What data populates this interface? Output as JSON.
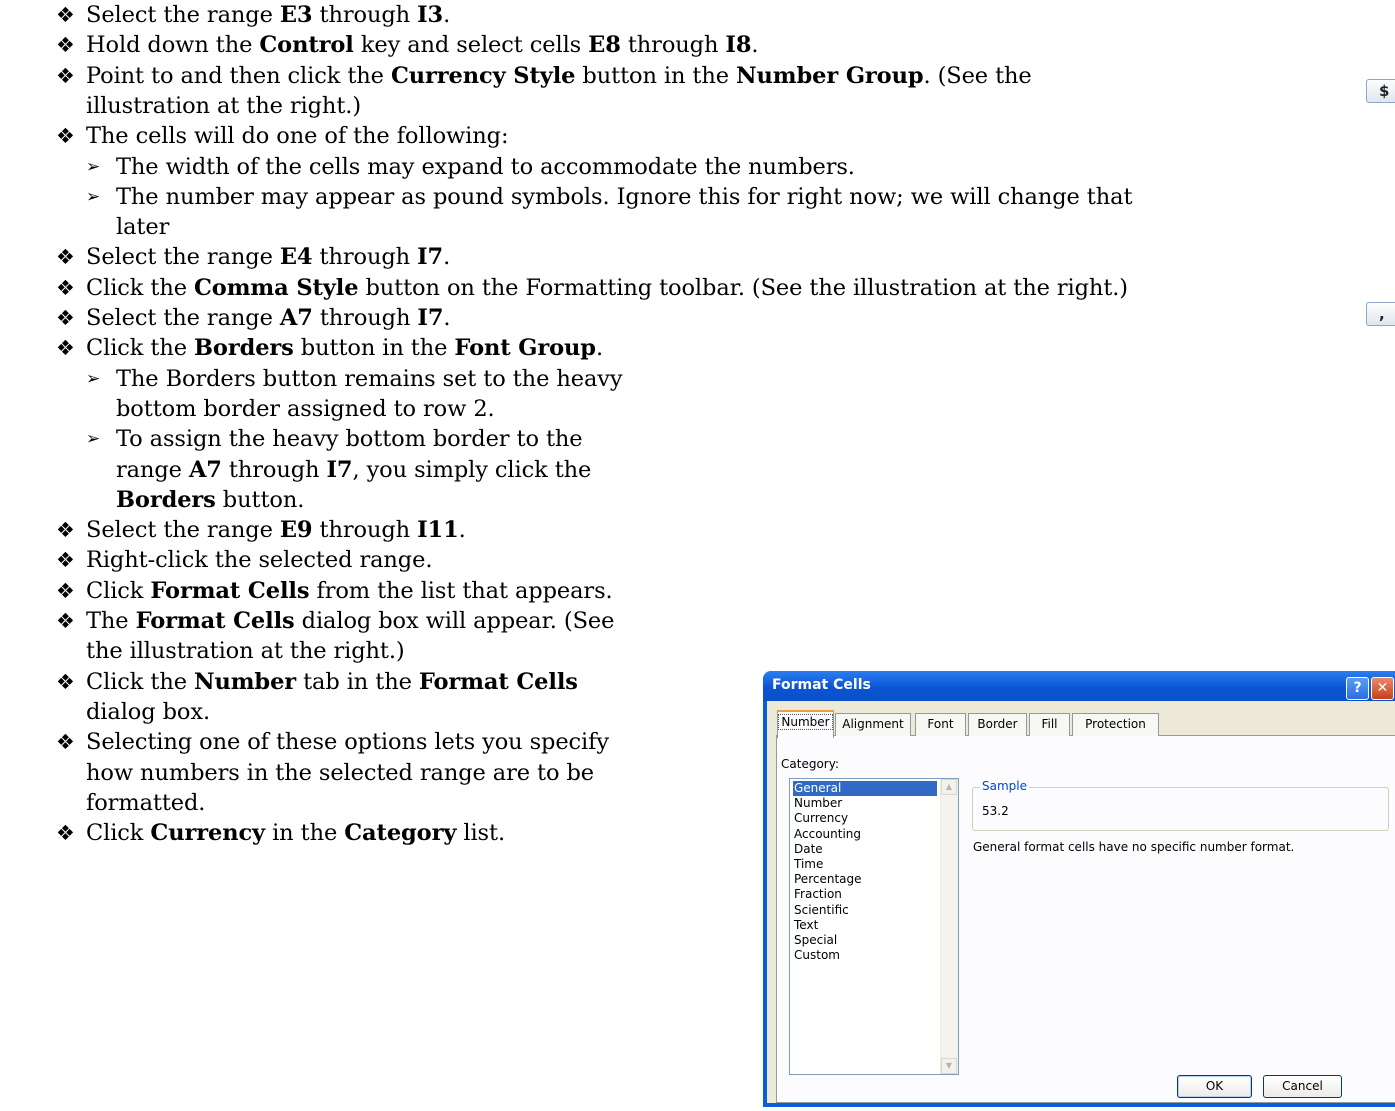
{
  "instructions": [
    {
      "kind": "bullet",
      "parts": [
        {
          "t": "Select the range "
        },
        {
          "t": "E3",
          "b": true
        },
        {
          "t": " through "
        },
        {
          "t": "I3",
          "b": true
        },
        {
          "t": "."
        }
      ]
    },
    {
      "kind": "bullet",
      "parts": [
        {
          "t": "Hold down the "
        },
        {
          "t": "Control",
          "b": true
        },
        {
          "t": " key and select cells "
        },
        {
          "t": "E8",
          "b": true
        },
        {
          "t": " through "
        },
        {
          "t": "I8",
          "b": true
        },
        {
          "t": "."
        }
      ]
    },
    {
      "kind": "bullet",
      "parts": [
        {
          "t": "Point to and then click the "
        },
        {
          "t": "Currency Style",
          "b": true
        },
        {
          "t": " button in the "
        },
        {
          "t": "Number Group",
          "b": true
        },
        {
          "t": ". (See the"
        }
      ]
    },
    {
      "kind": "cont1",
      "parts": [
        {
          "t": "illustration at the right.)"
        }
      ]
    },
    {
      "kind": "bullet",
      "parts": [
        {
          "t": "The cells will do one of the following:"
        }
      ]
    },
    {
      "kind": "arrow",
      "parts": [
        {
          "t": "The width of the cells may expand to accommodate the numbers."
        }
      ]
    },
    {
      "kind": "arrow",
      "parts": [
        {
          "t": "The number may appear as pound symbols. Ignore this for right now; we will change that"
        }
      ]
    },
    {
      "kind": "cont2",
      "parts": [
        {
          "t": "later"
        }
      ]
    },
    {
      "kind": "bullet",
      "parts": [
        {
          "t": "Select the range "
        },
        {
          "t": "E4",
          "b": true
        },
        {
          "t": " through "
        },
        {
          "t": "I7",
          "b": true
        },
        {
          "t": "."
        }
      ]
    },
    {
      "kind": "bullet",
      "parts": [
        {
          "t": "Click the "
        },
        {
          "t": "Comma Style",
          "b": true
        },
        {
          "t": " button on the Formatting toolbar. (See the illustration at the right.)"
        }
      ]
    },
    {
      "kind": "bullet",
      "parts": [
        {
          "t": "Select the range "
        },
        {
          "t": "A7",
          "b": true
        },
        {
          "t": " through "
        },
        {
          "t": "I7",
          "b": true
        },
        {
          "t": "."
        }
      ]
    },
    {
      "kind": "bullet",
      "parts": [
        {
          "t": "Click the "
        },
        {
          "t": "Borders",
          "b": true
        },
        {
          "t": " button in the "
        },
        {
          "t": "Font Group",
          "b": true
        },
        {
          "t": "."
        }
      ]
    },
    {
      "kind": "arrow",
      "parts": [
        {
          "t": "The Borders button remains set to the heavy"
        }
      ]
    },
    {
      "kind": "cont2",
      "parts": [
        {
          "t": "bottom border assigned to row 2."
        }
      ]
    },
    {
      "kind": "arrow",
      "parts": [
        {
          "t": "To assign the heavy bottom border to the"
        }
      ]
    },
    {
      "kind": "cont2",
      "parts": [
        {
          "t": "range "
        },
        {
          "t": "A7",
          "b": true
        },
        {
          "t": " through "
        },
        {
          "t": "I7",
          "b": true
        },
        {
          "t": ", you simply click the"
        }
      ]
    },
    {
      "kind": "cont2",
      "parts": [
        {
          "t": "Borders",
          "b": true
        },
        {
          "t": " button."
        }
      ]
    },
    {
      "kind": "bullet",
      "parts": [
        {
          "t": "Select the range "
        },
        {
          "t": "E9",
          "b": true
        },
        {
          "t": " through "
        },
        {
          "t": "I11",
          "b": true
        },
        {
          "t": "."
        }
      ]
    },
    {
      "kind": "bullet",
      "parts": [
        {
          "t": "Right-click the selected range."
        }
      ]
    },
    {
      "kind": "bullet",
      "parts": [
        {
          "t": "Click "
        },
        {
          "t": "Format Cells",
          "b": true
        },
        {
          "t": " from the list that appears."
        }
      ]
    },
    {
      "kind": "bullet",
      "parts": [
        {
          "t": "The "
        },
        {
          "t": "Format Cells",
          "b": true
        },
        {
          "t": " dialog box will appear. (See"
        }
      ]
    },
    {
      "kind": "cont1",
      "parts": [
        {
          "t": "the illustration at the right.)"
        }
      ]
    },
    {
      "kind": "bullet",
      "parts": [
        {
          "t": "Click the "
        },
        {
          "t": "Number",
          "b": true
        },
        {
          "t": " tab in the "
        },
        {
          "t": "Format Cells",
          "b": true
        }
      ]
    },
    {
      "kind": "cont1",
      "parts": [
        {
          "t": "dialog box."
        }
      ]
    },
    {
      "kind": "bullet",
      "parts": [
        {
          "t": "Selecting one of these options lets you specify"
        }
      ]
    },
    {
      "kind": "cont1",
      "parts": [
        {
          "t": "how numbers in the selected range are to be"
        }
      ]
    },
    {
      "kind": "cont1",
      "parts": [
        {
          "t": "formatted."
        }
      ]
    },
    {
      "kind": "bullet",
      "parts": [
        {
          "t": "Click "
        },
        {
          "t": "Currency",
          "b": true
        },
        {
          "t": " in the "
        },
        {
          "t": "Category",
          "b": true
        },
        {
          "t": " list."
        }
      ]
    }
  ],
  "bullet_glyph": "❖",
  "arrow_glyph": "➢",
  "toolbar_illustrations": {
    "currency_glyph": "$",
    "comma_glyph": ","
  },
  "dialog": {
    "title": "Format Cells",
    "help_glyph": "?",
    "close_glyph": "✕",
    "tabs": [
      "Number",
      "Alignment",
      "Font",
      "Border",
      "Fill",
      "Protection"
    ],
    "active_tab": "Number",
    "category_label": "Category:",
    "categories": [
      "General",
      "Number",
      "Currency",
      "Accounting",
      "Date",
      "Time",
      "Percentage",
      "Fraction",
      "Scientific",
      "Text",
      "Special",
      "Custom"
    ],
    "selected_category": "General",
    "sample_label": "Sample",
    "sample_value": "53.2",
    "description": "General format cells have no specific number format.",
    "ok_label": "OK",
    "cancel_label": "Cancel"
  }
}
